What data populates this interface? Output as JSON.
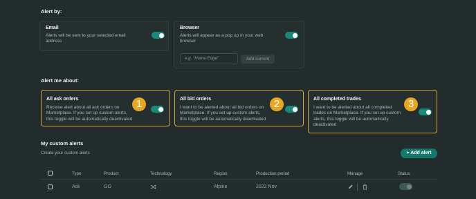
{
  "alert_by": {
    "title": "Alert by:",
    "email": {
      "title": "Email",
      "desc_line1": "Alerts will be sent to your selected email",
      "desc_line2": "address",
      "toggle_on": true
    },
    "browser": {
      "title": "Browser",
      "desc_line1": "Alerts will appear as a pop up in your web",
      "desc_line2": "browser",
      "toggle_on": true,
      "input_placeholder": "e.g. \"Home Edge\"",
      "add_current_label": "Add current"
    }
  },
  "alert_me_about": {
    "title": "Alert me about:",
    "cards": [
      {
        "title": "All ask orders",
        "lines": [
          "Receive alert about all ask orders on",
          "Marketplace. If you set up custom alerts,",
          "this toggle will be automatically deactivated"
        ],
        "badge": "1",
        "toggle_on": true
      },
      {
        "title": "All bid orders",
        "lines": [
          "I want to be alerted about all bid orders on",
          "Marketplace. If you set up custom alerts,",
          "this toggle will be automatically deactivated"
        ],
        "badge": "2",
        "toggle_on": true
      },
      {
        "title": "All completed trades",
        "lines": [
          "I want to be alerted about all completed",
          "trades on Marketplace. If you set up custom",
          "alerts, this toggle will be automatically",
          "deactivated"
        ],
        "badge": "3",
        "toggle_on": true
      }
    ]
  },
  "custom_alerts": {
    "title": "My custom alerts",
    "subtitle": "Create your custom alerts",
    "add_alert_label": "+ Add alert",
    "columns": [
      "Type",
      "Product",
      "Technology",
      "Region",
      "Production period",
      "Manage",
      "Status"
    ],
    "rows": [
      {
        "type": "Ask",
        "product": "GO",
        "technology_icon": "shuffle-icon",
        "region": "Alpine",
        "production_period": "2022 Nov",
        "status_on": false
      }
    ]
  },
  "colors": {
    "background": "#232c2c",
    "accent": "#1a8a78",
    "highlight": "#d7a736",
    "badge": "#e8a723"
  }
}
